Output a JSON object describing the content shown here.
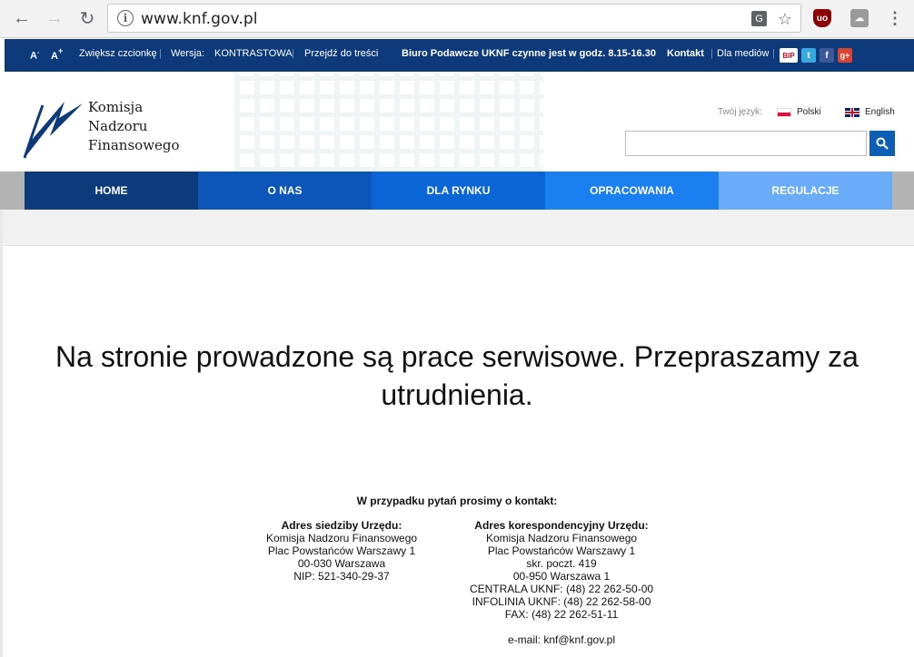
{
  "browser": {
    "url": "www.knf.gov.pl"
  },
  "topbar": {
    "font_small": "A",
    "font_small_sup": "-",
    "font_big": "A",
    "font_big_sup": "+",
    "increase_font": "Zwiększ czcionkę",
    "version_label": "Wersja:",
    "version_value": "KONTRASTOWA",
    "skip_to_content": "Przejdź do treści",
    "office_hours": "Biuro Podawcze UKNF czynne jest w godz. 8.15-16.30",
    "contact": "Kontakt",
    "media": "Dla mediów",
    "social": [
      "BIP",
      "t",
      "f",
      "g+"
    ]
  },
  "header": {
    "logo_lines": [
      "Komisja",
      "Nadzoru",
      "Finansowego"
    ],
    "lang_label": "Twój język:",
    "lang_pl": "Polski",
    "lang_en": "English",
    "search_placeholder": ""
  },
  "nav": [
    {
      "label": "HOME",
      "color": "#0d3a7a"
    },
    {
      "label": "O NAS",
      "color": "#0b56b8"
    },
    {
      "label": "DLA RYNKU",
      "color": "#0a66d6"
    },
    {
      "label": "OPRACOWANIA",
      "color": "#1a7ff0"
    },
    {
      "label": "REGULACJE",
      "color": "#6aacf7"
    }
  ],
  "notice": {
    "line1": "Na stronie prowadzone są prace serwisowe. Przepraszamy za",
    "line2": "utrudnienia."
  },
  "contact": {
    "title": "W przypadku pytań prosimy o kontakt:",
    "seat": {
      "heading": "Adres siedziby Urzędu:",
      "lines": [
        "Komisja Nadzoru Finansowego",
        "Plac Powstańców Warszawy 1",
        "00-030 Warszawa",
        "NIP: 521-340-29-37"
      ]
    },
    "correspondence": {
      "heading": "Adres korespondencyjny Urzędu:",
      "lines": [
        "Komisja Nadzoru Finansowego",
        "Plac Powstańców Warszawy 1",
        "skr. poczt. 419",
        "00-950 Warszawa 1",
        "CENTRALA UKNF: (48) 22 262-50-00",
        "INFOLINIA UKNF: (48) 22 262-58-00",
        "FAX: (48) 22 262-51-11",
        "",
        "e-mail: knf@knf.gov.pl"
      ]
    }
  }
}
